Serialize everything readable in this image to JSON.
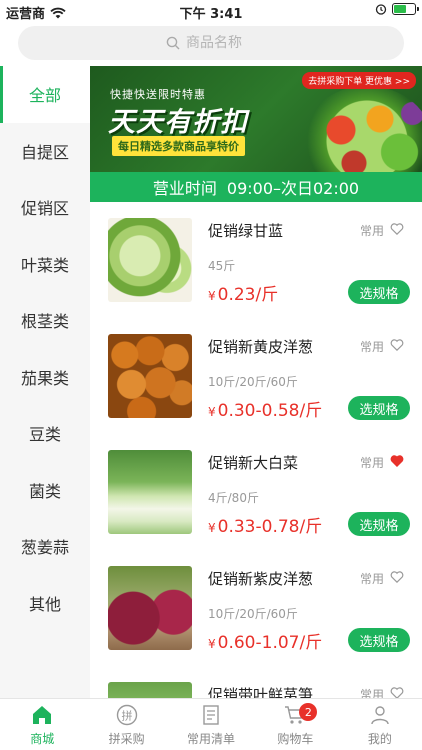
{
  "status_bar": {
    "carrier": "运营商",
    "time": "下午 3:41",
    "battery_level": 0.55
  },
  "search": {
    "placeholder": "商品名称"
  },
  "sidebar": {
    "items": [
      {
        "label": "全部",
        "active": true
      },
      {
        "label": "自提区"
      },
      {
        "label": "促销区"
      },
      {
        "label": "叶菜类"
      },
      {
        "label": "根茎类"
      },
      {
        "label": "茄果类"
      },
      {
        "label": "豆类"
      },
      {
        "label": "菌类"
      },
      {
        "label": "葱姜蒜"
      },
      {
        "label": "其他"
      }
    ]
  },
  "banner": {
    "top_text": "快捷快送限时特惠",
    "main_text": "天天有折扣",
    "sub_text": "每日精选多款商品享特价",
    "tag_text": "去拼采购下单 更优惠 >>"
  },
  "hours": {
    "label": "营业时间",
    "value": "09:00–次日02:00"
  },
  "products": [
    {
      "name": "促销绿甘蓝",
      "tag": "常用",
      "spec": "45斤",
      "currency": "¥",
      "price": "0.23/斤",
      "button": "选规格",
      "favorited": false,
      "thumb": "cabbage"
    },
    {
      "name": "促销新黄皮洋葱",
      "tag": "常用",
      "spec": "10斤/20斤/60斤",
      "currency": "¥",
      "price": "0.30-0.58/斤",
      "button": "选规格",
      "favorited": false,
      "thumb": "onion"
    },
    {
      "name": "促销新大白菜",
      "tag": "常用",
      "spec": "4斤/80斤",
      "currency": "¥",
      "price": "0.33-0.78/斤",
      "button": "选规格",
      "favorited": true,
      "thumb": "napa"
    },
    {
      "name": "促销新紫皮洋葱",
      "tag": "常用",
      "spec": "10斤/20斤/60斤",
      "currency": "¥",
      "price": "0.60-1.07/斤",
      "button": "选规格",
      "favorited": false,
      "thumb": "redonion"
    },
    {
      "name": "促销带叶鲜莴笋",
      "tag": "常用",
      "spec": "",
      "currency": "",
      "price": "",
      "button": "",
      "favorited": false,
      "thumb": "lettuce"
    }
  ],
  "tabbar": {
    "tabs": [
      {
        "label": "商城",
        "icon": "home-icon",
        "active": true
      },
      {
        "label": "拼采购",
        "icon": "group-buy-icon"
      },
      {
        "label": "常用清单",
        "icon": "list-icon"
      },
      {
        "label": "购物车",
        "icon": "cart-icon",
        "badge": "2"
      },
      {
        "label": "我的",
        "icon": "user-icon"
      }
    ]
  },
  "colors": {
    "accent": "#1db35c",
    "price": "#e8312a",
    "favorite": "#e8312a"
  }
}
